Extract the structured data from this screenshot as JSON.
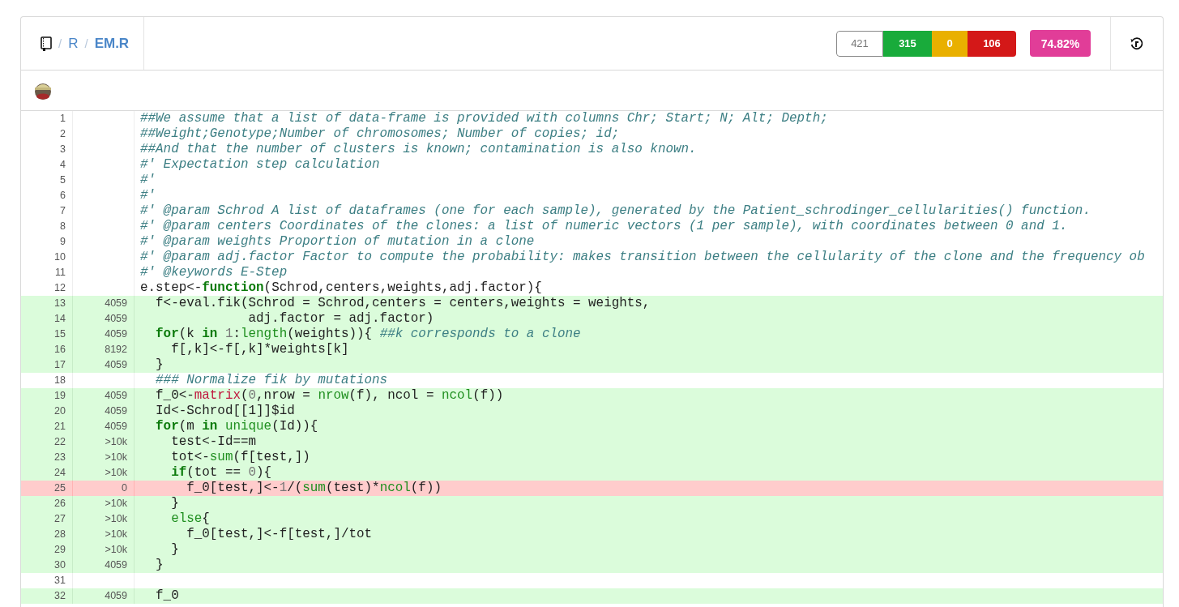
{
  "breadcrumb": {
    "items": [
      {
        "separator": "/",
        "label": "R",
        "current": false
      },
      {
        "separator": "/",
        "label": "EM.R",
        "current": true
      }
    ]
  },
  "stats": [
    {
      "label": "421",
      "color": "#ffffff"
    },
    {
      "label": "315",
      "color": "#19ab3b"
    },
    {
      "label": "0",
      "color": "#e9b000"
    },
    {
      "label": "106",
      "color": "#d41818"
    }
  ],
  "coverage": {
    "label": "74.82%",
    "color": "#e13d98"
  },
  "lines": [
    {
      "number": "1",
      "kind": "neutral",
      "segments": [
        {
          "kind": "comment",
          "text": "##We assume that a list of data-frame is provided with columns Chr; Start; N; Alt; Depth;"
        }
      ]
    },
    {
      "number": "2",
      "kind": "neutral",
      "segments": [
        {
          "kind": "comment",
          "text": "##Weight;Genotype;Number of chromosomes; Number of copies; id;"
        }
      ]
    },
    {
      "number": "3",
      "kind": "neutral",
      "segments": [
        {
          "kind": "comment",
          "text": "##And that the number of clusters is known; contamination is also known."
        }
      ]
    },
    {
      "number": "4",
      "kind": "neutral",
      "segments": [
        {
          "kind": "comment",
          "text": "#' Expectation step calculation"
        }
      ]
    },
    {
      "number": "5",
      "kind": "neutral",
      "segments": [
        {
          "kind": "comment",
          "text": "#'"
        }
      ]
    },
    {
      "number": "6",
      "kind": "neutral",
      "segments": [
        {
          "kind": "comment",
          "text": "#'"
        }
      ]
    },
    {
      "number": "7",
      "kind": "neutral",
      "segments": [
        {
          "kind": "comment",
          "text": "#' @param Schrod A list of dataframes (one for each sample), generated by the Patient_schrodinger_cellularities() function."
        }
      ]
    },
    {
      "number": "8",
      "kind": "neutral",
      "segments": [
        {
          "kind": "comment",
          "text": "#' @param centers Coordinates of the clones: a list of numeric vectors (1 per sample), with coordinates between 0 and 1."
        }
      ]
    },
    {
      "number": "9",
      "kind": "neutral",
      "segments": [
        {
          "kind": "comment",
          "text": "#' @param weights Proportion of mutation in a clone"
        }
      ]
    },
    {
      "number": "10",
      "kind": "neutral",
      "segments": [
        {
          "kind": "comment",
          "text": "#' @param adj.factor Factor to compute the probability: makes transition between the cellularity of the clone and the frequency ob"
        }
      ]
    },
    {
      "number": "11",
      "kind": "neutral",
      "segments": [
        {
          "kind": "comment",
          "text": "#' @keywords E-Step"
        }
      ]
    },
    {
      "number": "12",
      "kind": "neutral",
      "segments": [
        {
          "kind": "plain",
          "text": "e.step<-"
        },
        {
          "kind": "keyword",
          "text": "function"
        },
        {
          "kind": "plain",
          "text": "(Schrod,centers,weights,adj.factor){"
        }
      ]
    },
    {
      "number": "13",
      "kind": "covered",
      "hits": "4059",
      "segments": [
        {
          "kind": "plain",
          "text": "  f<-eval.fik(Schrod = Schrod,centers = centers,weights = weights,"
        }
      ]
    },
    {
      "number": "14",
      "kind": "covered",
      "hits": "4059",
      "segments": [
        {
          "kind": "plain",
          "text": "              adj.factor = adj.factor)"
        }
      ]
    },
    {
      "number": "15",
      "kind": "covered",
      "hits": "4059",
      "segments": [
        {
          "kind": "keyword",
          "text": "  for"
        },
        {
          "kind": "plain",
          "text": "(k "
        },
        {
          "kind": "keyword",
          "text": "in "
        },
        {
          "kind": "number",
          "text": "1"
        },
        {
          "kind": "plain",
          "text": ":"
        },
        {
          "kind": "builtin",
          "text": "length"
        },
        {
          "kind": "plain",
          "text": "(weights)){ "
        },
        {
          "kind": "comment",
          "text": "##k corresponds to a clone"
        }
      ]
    },
    {
      "number": "16",
      "kind": "covered",
      "hits": "8192",
      "segments": [
        {
          "kind": "plain",
          "text": "    f[,k]<-f[,k]*weights[k]"
        }
      ]
    },
    {
      "number": "17",
      "kind": "covered",
      "hits": "4059",
      "segments": [
        {
          "kind": "plain",
          "text": "  }"
        }
      ]
    },
    {
      "number": "18",
      "kind": "neutral",
      "segments": [
        {
          "kind": "comment",
          "text": "  ### Normalize fik by mutations"
        }
      ]
    },
    {
      "number": "19",
      "kind": "covered",
      "hits": "4059",
      "segments": [
        {
          "kind": "plain",
          "text": "  f_0<-"
        },
        {
          "kind": "function",
          "text": "matrix"
        },
        {
          "kind": "plain",
          "text": "("
        },
        {
          "kind": "number",
          "text": "0"
        },
        {
          "kind": "plain",
          "text": ",nrow = "
        },
        {
          "kind": "builtin",
          "text": "nrow"
        },
        {
          "kind": "plain",
          "text": "(f), ncol = "
        },
        {
          "kind": "builtin",
          "text": "ncol"
        },
        {
          "kind": "plain",
          "text": "(f))"
        }
      ]
    },
    {
      "number": "20",
      "kind": "covered",
      "hits": "4059",
      "segments": [
        {
          "kind": "plain",
          "text": "  Id<-Schrod[[1]]$id"
        }
      ]
    },
    {
      "number": "21",
      "kind": "covered",
      "hits": "4059",
      "segments": [
        {
          "kind": "keyword",
          "text": "  for"
        },
        {
          "kind": "plain",
          "text": "(m "
        },
        {
          "kind": "keyword",
          "text": "in "
        },
        {
          "kind": "builtin",
          "text": "unique"
        },
        {
          "kind": "plain",
          "text": "(Id)){"
        }
      ]
    },
    {
      "number": "22",
      "kind": "covered",
      "hits": ">10k",
      "segments": [
        {
          "kind": "plain",
          "text": "    test<-Id==m"
        }
      ]
    },
    {
      "number": "23",
      "kind": "covered",
      "hits": ">10k",
      "segments": [
        {
          "kind": "plain",
          "text": "    tot<-"
        },
        {
          "kind": "builtin",
          "text": "sum"
        },
        {
          "kind": "plain",
          "text": "(f[test,])"
        }
      ]
    },
    {
      "number": "24",
      "kind": "covered",
      "hits": ">10k",
      "segments": [
        {
          "kind": "keyword",
          "text": "    if"
        },
        {
          "kind": "plain",
          "text": "(tot == "
        },
        {
          "kind": "number",
          "text": "0"
        },
        {
          "kind": "plain",
          "text": "){"
        }
      ]
    },
    {
      "number": "25",
      "kind": "missed",
      "hits": "0",
      "segments": [
        {
          "kind": "plain",
          "text": "      f_0[test,]<-"
        },
        {
          "kind": "number",
          "text": "1"
        },
        {
          "kind": "plain",
          "text": "/("
        },
        {
          "kind": "builtin",
          "text": "sum"
        },
        {
          "kind": "plain",
          "text": "(test)*"
        },
        {
          "kind": "builtin",
          "text": "ncol"
        },
        {
          "kind": "plain",
          "text": "(f))"
        }
      ]
    },
    {
      "number": "26",
      "kind": "covered",
      "hits": ">10k",
      "segments": [
        {
          "kind": "plain",
          "text": "    }"
        }
      ]
    },
    {
      "number": "27",
      "kind": "covered",
      "hits": ">10k",
      "segments": [
        {
          "kind": "builtin",
          "text": "    else"
        },
        {
          "kind": "plain",
          "text": "{"
        }
      ]
    },
    {
      "number": "28",
      "kind": "covered",
      "hits": ">10k",
      "segments": [
        {
          "kind": "plain",
          "text": "      f_0[test,]<-f[test,]/tot"
        }
      ]
    },
    {
      "number": "29",
      "kind": "covered",
      "hits": ">10k",
      "segments": [
        {
          "kind": "plain",
          "text": "    }"
        }
      ]
    },
    {
      "number": "30",
      "kind": "covered",
      "hits": "4059",
      "segments": [
        {
          "kind": "plain",
          "text": "  }"
        }
      ]
    },
    {
      "number": "31",
      "kind": "neutral"
    },
    {
      "number": "32",
      "kind": "covered",
      "hits": "4059",
      "segments": [
        {
          "kind": "plain",
          "text": "  f_0"
        }
      ]
    }
  ]
}
